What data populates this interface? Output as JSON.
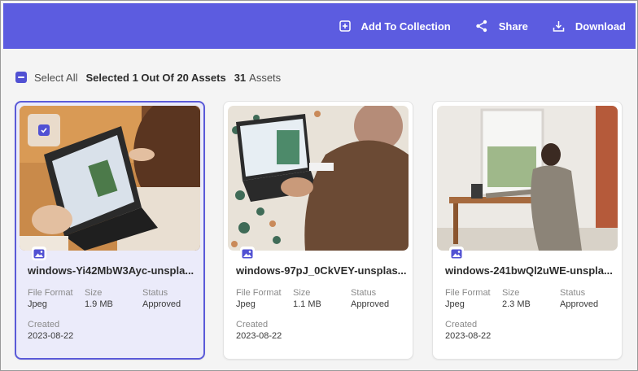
{
  "header": {
    "add_to_collection": "Add To Collection",
    "share": "Share",
    "download": "Download",
    "accent_color": "#5c5ce0"
  },
  "toolbar": {
    "select_all": "Select All",
    "selected_text": "Selected 1 Out Of 20 Assets",
    "assets_count": "31",
    "assets_label": "Assets"
  },
  "labels": {
    "file_format": "File Format",
    "size": "Size",
    "status": "Status",
    "created": "Created"
  },
  "cards": [
    {
      "name": "windows-Yi42MbW3Ayc-unspla...",
      "file_format": "Jpeg",
      "size": "1.9 MB",
      "status": "Approved",
      "created": "2023-08-22",
      "selected": true
    },
    {
      "name": "windows-97pJ_0CkVEY-unsplas...",
      "file_format": "Jpeg",
      "size": "1.1 MB",
      "status": "Approved",
      "created": "2023-08-22",
      "selected": false
    },
    {
      "name": "windows-241bwQl2uWE-unspla...",
      "file_format": "Jpeg",
      "size": "2.3 MB",
      "status": "Approved",
      "created": "2023-08-22",
      "selected": false
    }
  ]
}
